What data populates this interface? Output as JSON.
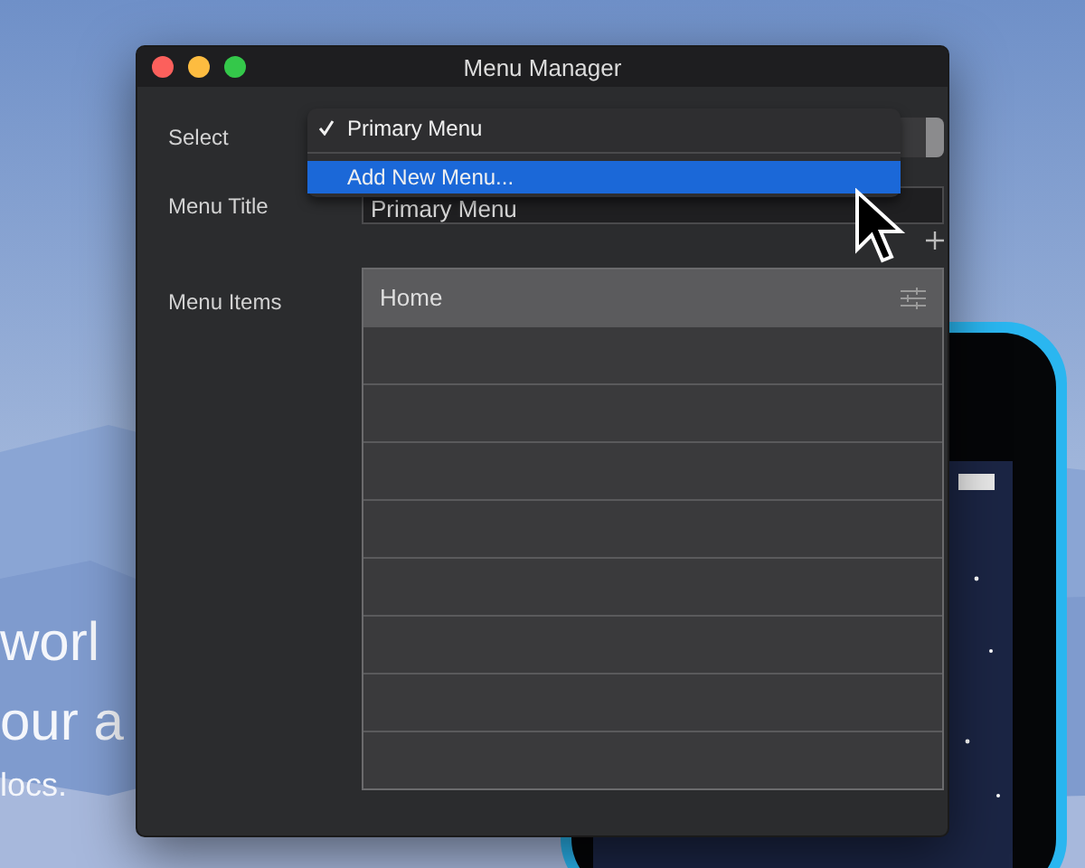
{
  "backdrop": {
    "lines": [
      "worl",
      "our a",
      "locs."
    ]
  },
  "window": {
    "title": "Menu Manager"
  },
  "form": {
    "select_label": "Select",
    "title_label": "Menu Title",
    "title_value": "Primary Menu",
    "items_label": "Menu Items"
  },
  "dropdown": {
    "items": [
      {
        "label": "Primary Menu",
        "checked": true,
        "selected": false
      },
      {
        "label": "Add New Menu...",
        "checked": false,
        "selected": true
      }
    ]
  },
  "menu_items": {
    "header": "Home"
  }
}
